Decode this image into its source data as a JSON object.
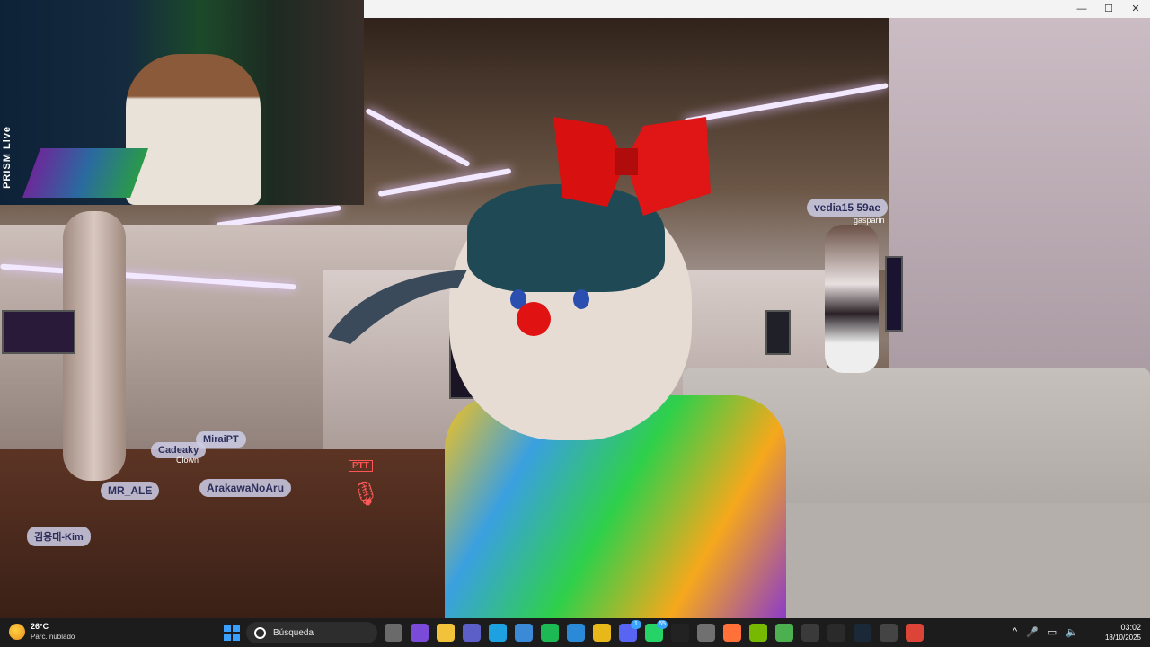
{
  "window": {
    "minimize_icon": "minimize-icon",
    "maximize_icon": "maximize-icon",
    "close_icon": "close-icon"
  },
  "webcam": {
    "overlay_label": "PRISM Live"
  },
  "vr_scene": {
    "nametags": [
      {
        "name": "vedia15 59ae",
        "subtitle": "gasparin"
      },
      {
        "name": "MiraiPT"
      },
      {
        "name": "Cadeaky",
        "subtitle": "Clown"
      },
      {
        "name": "ArakawaNoAru"
      },
      {
        "name": "MR_ALE"
      },
      {
        "name": "김용대-Kim"
      }
    ],
    "ptt_label": "PTT",
    "muted_mic_icon": "mic-muted-icon"
  },
  "taskbar": {
    "weather": {
      "temp": "26°C",
      "condition": "Parc. nublado"
    },
    "search_placeholder": "Búsqueda",
    "apps": [
      {
        "name": "task-view",
        "color": "#6a6a6a"
      },
      {
        "name": "copilot",
        "color": "#7a4ad8"
      },
      {
        "name": "file-explorer",
        "color": "#f2c23a"
      },
      {
        "name": "teams",
        "color": "#5b5fc7"
      },
      {
        "name": "edge",
        "color": "#1ea1e0"
      },
      {
        "name": "microsoft-store",
        "color": "#3a8ad8"
      },
      {
        "name": "spotify",
        "color": "#1db954"
      },
      {
        "name": "app-blue",
        "color": "#2a8ad8"
      },
      {
        "name": "chrome",
        "color": "#e8b81a"
      },
      {
        "name": "discord",
        "color": "#5865f2",
        "badge": "1"
      },
      {
        "name": "whatsapp",
        "color": "#25d366",
        "badge": "65"
      },
      {
        "name": "tiktok",
        "color": "#222222"
      },
      {
        "name": "app-gray",
        "color": "#707070"
      },
      {
        "name": "firefox",
        "color": "#ff7139"
      },
      {
        "name": "nvidia",
        "color": "#76b900"
      },
      {
        "name": "chrome-profile",
        "color": "#4caf50"
      },
      {
        "name": "app-dark",
        "color": "#3a3a3a"
      },
      {
        "name": "obs",
        "color": "#2a2a2a"
      },
      {
        "name": "steam",
        "color": "#1b2838"
      },
      {
        "name": "vr",
        "color": "#444444"
      },
      {
        "name": "chrome-2",
        "color": "#db4437"
      }
    ],
    "clock": {
      "time": "03:02",
      "date": "18/10/2025"
    }
  }
}
